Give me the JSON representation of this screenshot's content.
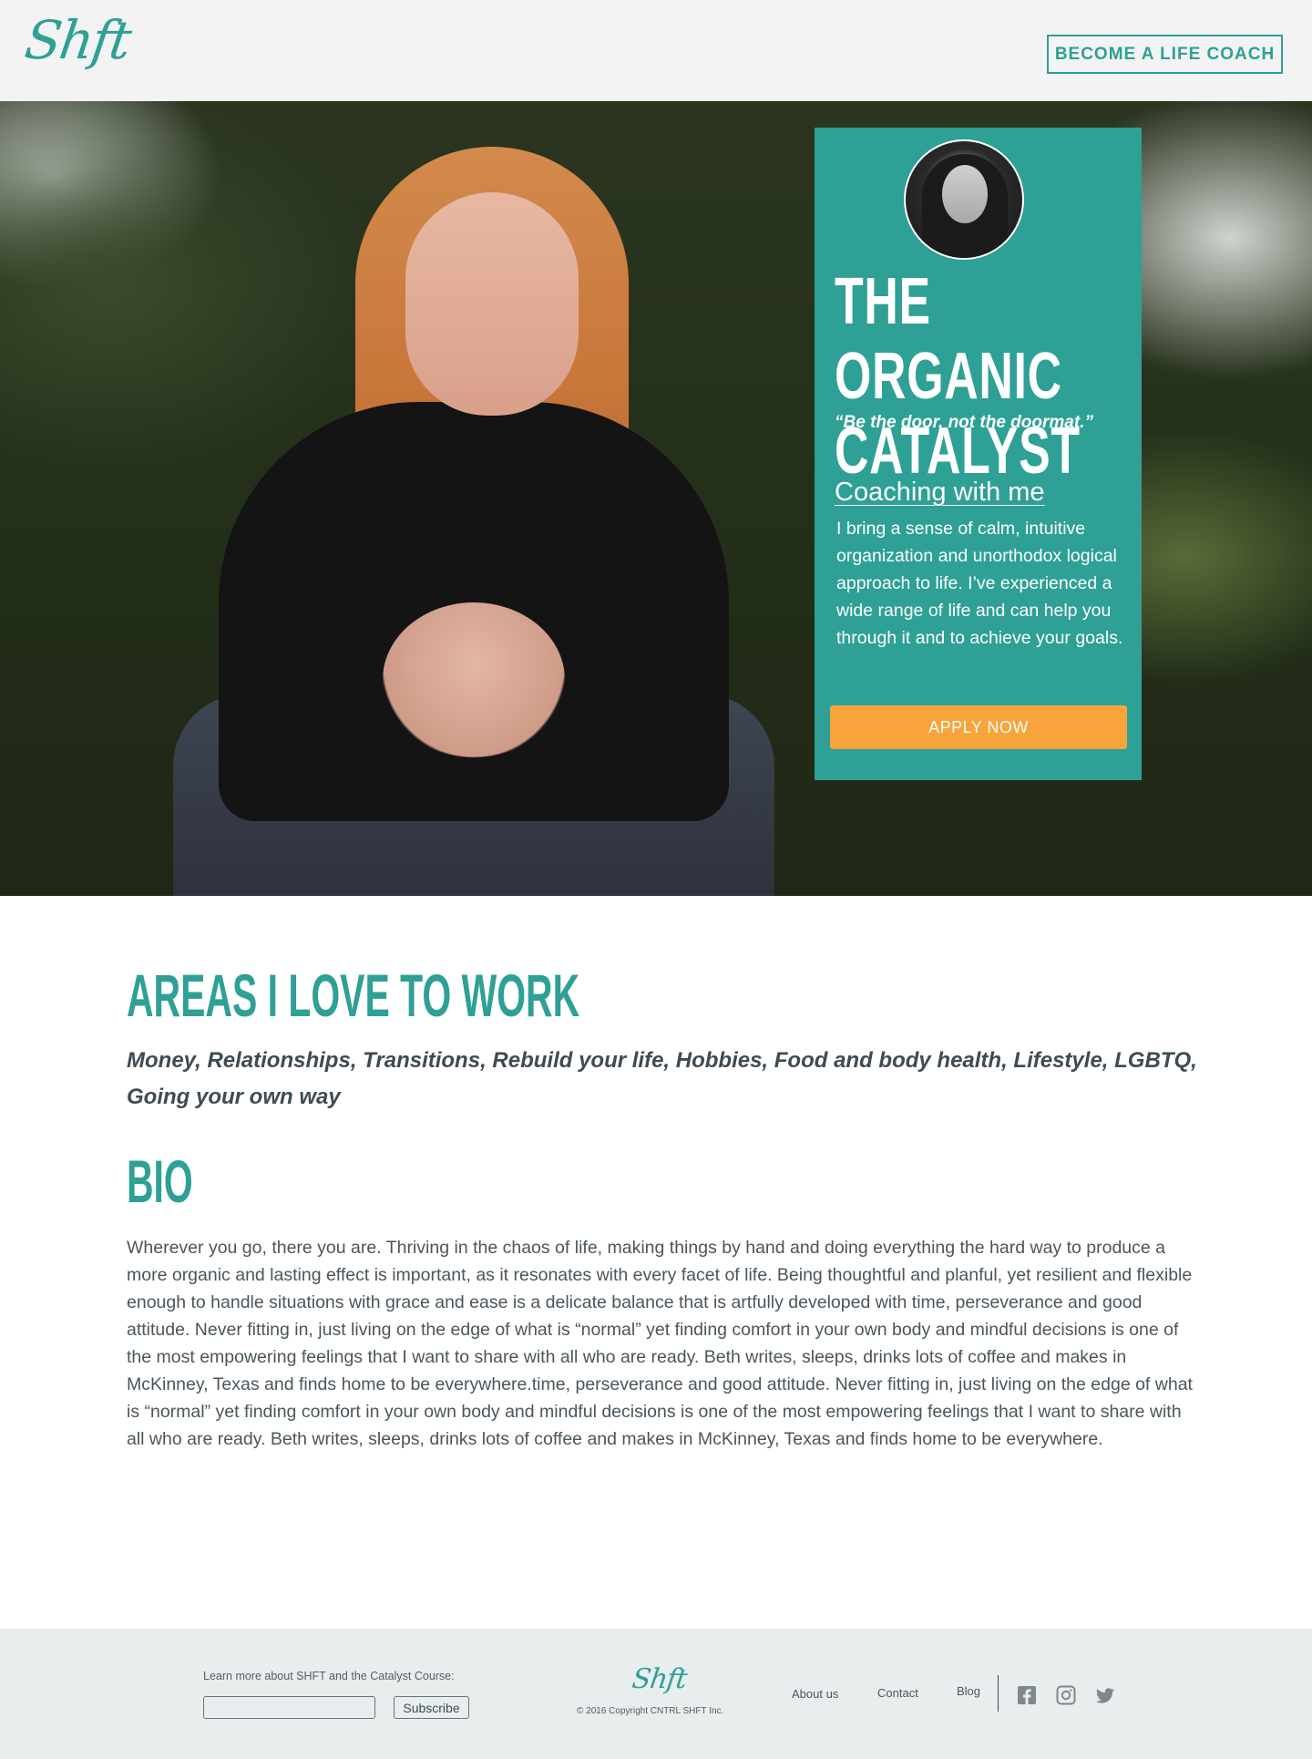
{
  "header": {
    "logo": "Shft",
    "cta_label": "BECOME A LIFE COACH"
  },
  "card": {
    "title_line1": "THE ORGANIC",
    "title_line2": "CATALYST",
    "quote": "“Be the door, not the doormat.”",
    "heading": "Coaching with me",
    "text": "I bring a sense of calm, intuitive organization and unorthodox logical approach to life. I’ve experienced a wide range of life and can help you through it and to achieve your goals.",
    "apply_label": "APPLY NOW"
  },
  "areas": {
    "title": "AREAS I LOVE TO WORK",
    "list": "Money, Relationships, Transitions, Rebuild your life, Hobbies, Food and body health, Lifestyle, LGBTQ, Going your own way"
  },
  "bio": {
    "title": "BIO",
    "text": "Wherever you go, there you are. Thriving in the chaos of life, making things by hand and doing everything the hard way to produce a more organic and lasting effect is important, as it resonates with every facet of life. Being thoughtful and planful, yet resilient and flexible enough to handle situations with grace and ease is a delicate balance that is artfully developed with time, perseverance and good attitude. Never fitting in, just living on the edge of what is “normal” yet finding comfort in your own body and mindful decisions is one of the most empowering feelings that I want to share with all who are ready. Beth writes, sleeps, drinks lots of coffee and makes in McKinney, Texas and finds home to be everywhere.time, perseverance and good attitude. Never fitting in, just living on the edge of what is “normal” yet finding comfort in your own body and mindful decisions is one of the most empowering feelings that I want to share with all who are ready. Beth writes, sleeps, drinks lots of coffee and makes in McKinney, Texas and finds home to be everywhere."
  },
  "footer": {
    "newsletter_label": "Learn more about SHFT and the Catalyst Course:",
    "newsletter_value": "",
    "subscribe_label": "Subscribe",
    "logo": "Shft",
    "copyright": "© 2016 Copyright CNTRL SHFT Inc.",
    "links": {
      "about": "About us",
      "contact": "Contact",
      "blog": "Blog"
    },
    "social_icons": [
      "facebook-icon",
      "instagram-icon",
      "twitter-icon"
    ]
  },
  "colors": {
    "brand_teal": "#2ea095",
    "accent_orange": "#f9a43a",
    "header_bg": "#f3f3f3",
    "footer_bg": "#e8eded",
    "text_dark": "#3e4b52"
  }
}
